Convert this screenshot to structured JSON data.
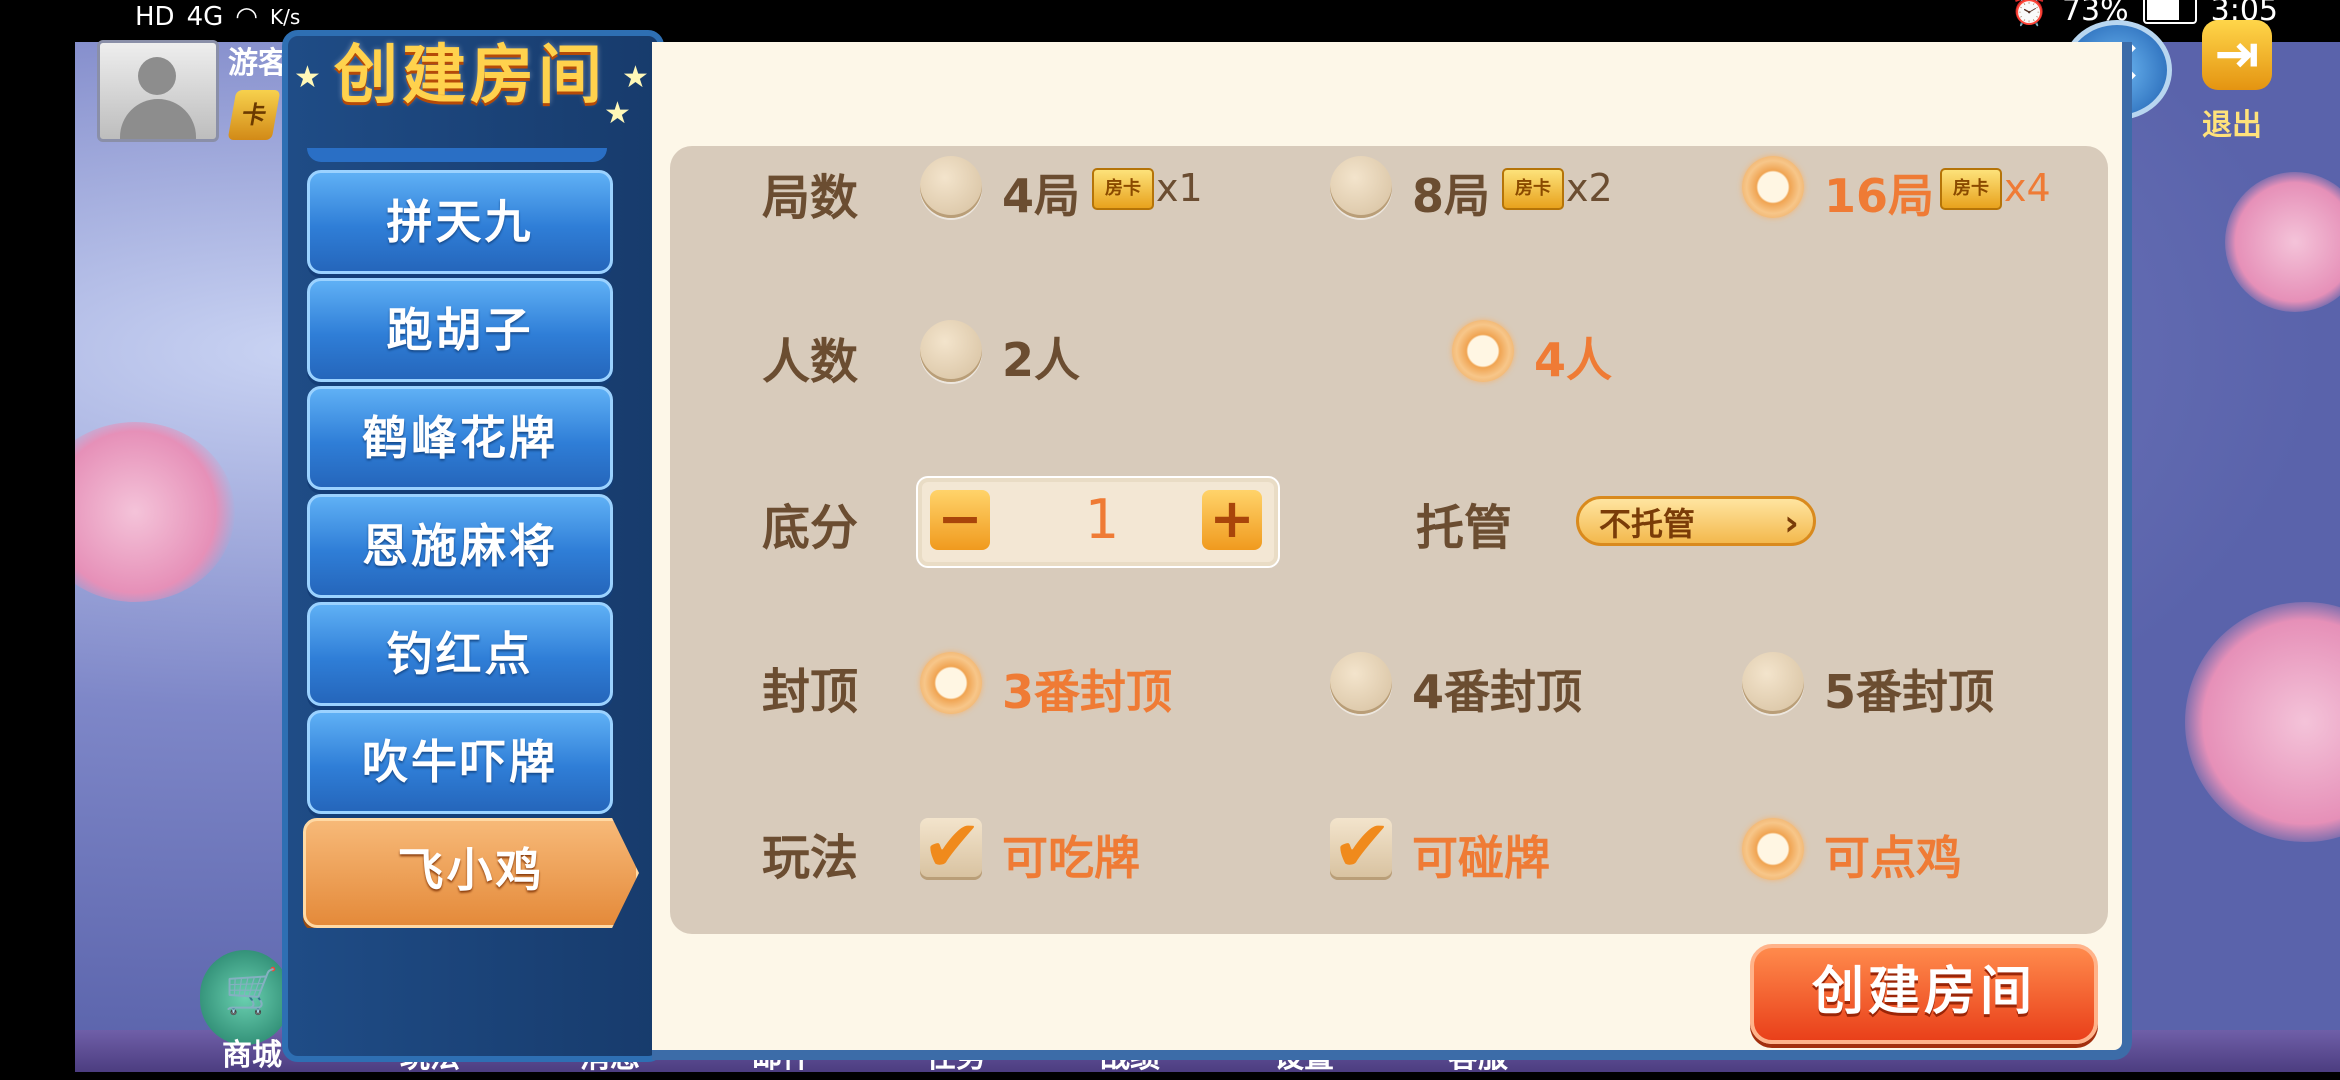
{
  "status_bar": {
    "hd": "HD",
    "signal": "4G",
    "speed": "K/s",
    "battery_percent": "73%",
    "battery_level": 0.73,
    "time": "3:05"
  },
  "player": {
    "name": "游客",
    "card_badge": "卡"
  },
  "header": {
    "title": "创建房间",
    "close_icon": "×",
    "exit_label": "退出",
    "exit_icon": "⇥"
  },
  "sidebar": {
    "items": [
      {
        "label": "拼天九",
        "active": false
      },
      {
        "label": "跑胡子",
        "active": false
      },
      {
        "label": "鹤峰花牌",
        "active": false
      },
      {
        "label": "恩施麻将",
        "active": false
      },
      {
        "label": "钓红点",
        "active": false
      },
      {
        "label": "吹牛吓牌",
        "active": false
      },
      {
        "label": "飞小鸡",
        "active": true
      }
    ]
  },
  "options": {
    "rounds": {
      "label": "局数",
      "choices": [
        {
          "text": "4局",
          "card": "房卡",
          "mult": "x1",
          "selected": false
        },
        {
          "text": "8局",
          "card": "房卡",
          "mult": "x2",
          "selected": false
        },
        {
          "text": "16局",
          "card": "房卡",
          "mult": "x4",
          "selected": true
        }
      ]
    },
    "players": {
      "label": "人数",
      "choices": [
        {
          "text": "2人",
          "selected": false
        },
        {
          "text": "4人",
          "selected": true
        }
      ]
    },
    "base_score": {
      "label": "底分",
      "minus": "−",
      "value": "1",
      "plus": "+"
    },
    "hosting": {
      "label": "托管",
      "value": "不托管",
      "arrow": "›"
    },
    "cap": {
      "label": "封顶",
      "choices": [
        {
          "text": "3番封顶",
          "selected": true
        },
        {
          "text": "4番封顶",
          "selected": false
        },
        {
          "text": "5番封顶",
          "selected": false
        }
      ]
    },
    "rules": {
      "label": "玩法",
      "choices": [
        {
          "text": "可吃牌",
          "type": "checkbox",
          "checked": true
        },
        {
          "text": "可碰牌",
          "type": "checkbox",
          "checked": true
        },
        {
          "text": "可点鸡",
          "type": "radio",
          "checked": true
        }
      ]
    }
  },
  "create_button": "创建房间",
  "bottom": {
    "shop_label": "商城",
    "shop_icon": "🛒",
    "dock_items": [
      "玩法",
      "消息",
      "邮件",
      "任务",
      "战绩",
      "设置",
      "客服"
    ]
  },
  "colors": {
    "accent": "#ef7b35",
    "text": "#6b4d31",
    "panel": "#d8cbbb",
    "sidebar": "#1f4c86"
  }
}
